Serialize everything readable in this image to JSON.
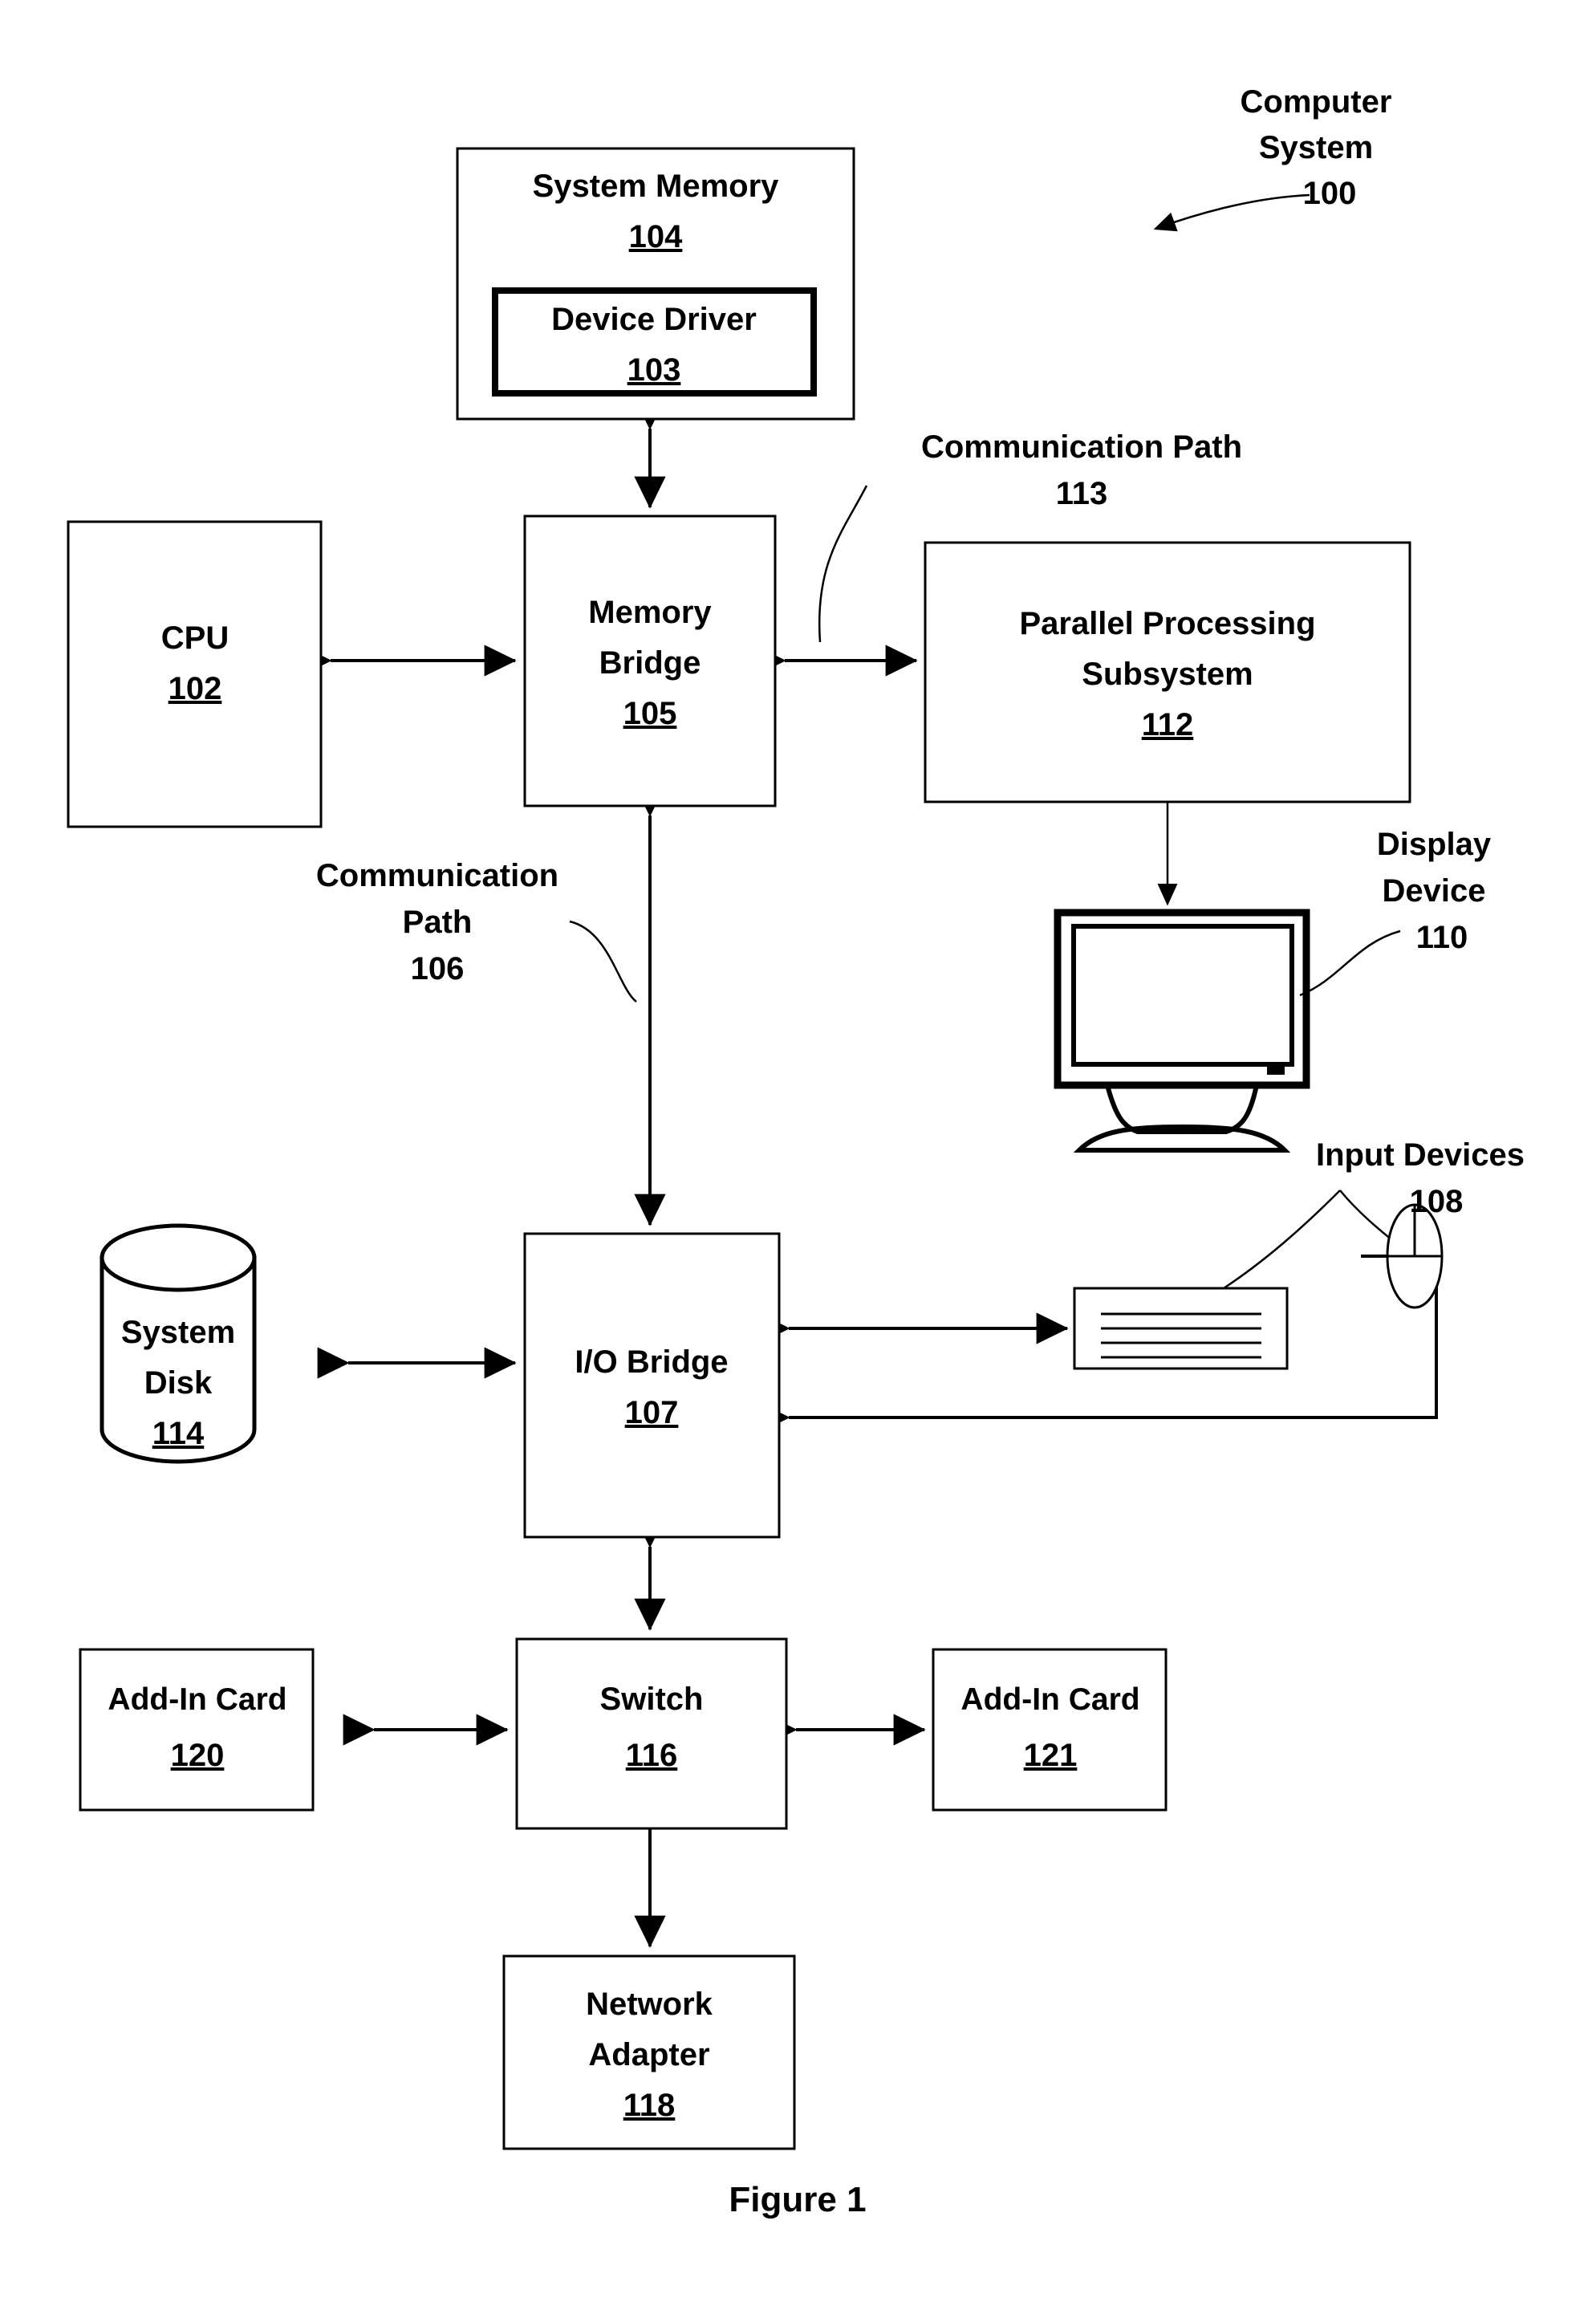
{
  "figure": {
    "caption": "Figure 1",
    "title_callout": {
      "line1": "Computer",
      "line2": "System",
      "ref": "100"
    }
  },
  "blocks": [
    {
      "id": "system-memory",
      "label_line1": "System Memory",
      "ref": "104"
    },
    {
      "id": "device-driver",
      "label_line1": "Device Driver",
      "ref": "103"
    },
    {
      "id": "cpu",
      "label_line1": "CPU",
      "ref": "102"
    },
    {
      "id": "memory-bridge",
      "label_line1": "Memory",
      "label_line2": "Bridge",
      "ref": "105"
    },
    {
      "id": "parallel-processing-subsystem",
      "label_line1": "Parallel Processing",
      "label_line2": "Subsystem",
      "ref": "112"
    },
    {
      "id": "io-bridge",
      "label_line1": "I/O Bridge",
      "ref": "107"
    },
    {
      "id": "system-disk",
      "label_line1": "System",
      "label_line2": "Disk",
      "ref": "114"
    },
    {
      "id": "add-in-card-120",
      "label_line1": "Add-In Card",
      "ref": "120"
    },
    {
      "id": "switch",
      "label_line1": "Switch",
      "ref": "116"
    },
    {
      "id": "add-in-card-121",
      "label_line1": "Add-In Card",
      "ref": "121"
    },
    {
      "id": "network-adapter",
      "label_line1": "Network",
      "label_line2": "Adapter",
      "ref": "118"
    }
  ],
  "callouts": [
    {
      "id": "communication-path-113",
      "line1": "Communication Path",
      "ref": "113"
    },
    {
      "id": "communication-path-106",
      "line1": "Communication",
      "line2": "Path",
      "ref": "106"
    },
    {
      "id": "display-device-110",
      "line1": "Display",
      "line2": "Device",
      "ref": "110"
    },
    {
      "id": "input-devices-108",
      "line1": "Input Devices",
      "ref": "108"
    }
  ],
  "text": {
    "system_memory": "System Memory",
    "system_memory_ref": "104",
    "device_driver": "Device Driver",
    "device_driver_ref": "103",
    "cpu": "CPU",
    "cpu_ref": "102",
    "memory_bridge_1": "Memory",
    "memory_bridge_2": "Bridge",
    "memory_bridge_ref": "105",
    "pps_1": "Parallel Processing",
    "pps_2": "Subsystem",
    "pps_ref": "112",
    "io_bridge": "I/O Bridge",
    "io_bridge_ref": "107",
    "system_disk_1": "System",
    "system_disk_2": "Disk",
    "system_disk_ref": "114",
    "add_in_card_120": "Add-In Card",
    "add_in_card_120_ref": "120",
    "switch": "Switch",
    "switch_ref": "116",
    "add_in_card_121": "Add-In Card",
    "add_in_card_121_ref": "121",
    "network_adapter_1": "Network",
    "network_adapter_2": "Adapter",
    "network_adapter_ref": "118",
    "computer_system_1": "Computer",
    "computer_system_2": "System",
    "computer_system_ref": "100",
    "comm_path_113_1": "Communication Path",
    "comm_path_113_ref": "113",
    "comm_path_106_1": "Communication",
    "comm_path_106_2": "Path",
    "comm_path_106_ref": "106",
    "display_device_1": "Display",
    "display_device_2": "Device",
    "display_device_ref": "110",
    "input_devices_1": "Input Devices",
    "input_devices_ref": "108",
    "figure_caption": "Figure 1"
  },
  "colors": {
    "ink": "#000000",
    "paper": "#ffffff"
  }
}
